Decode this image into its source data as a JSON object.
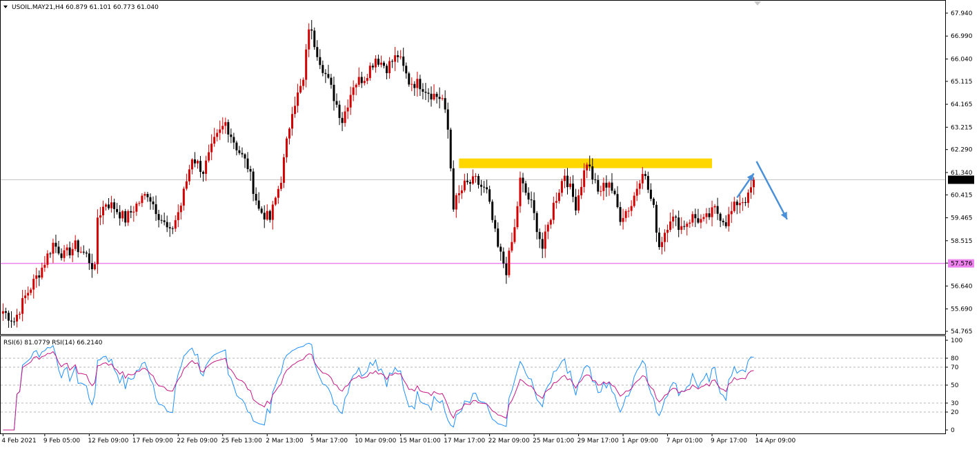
{
  "chart_data": [
    {
      "type": "candlestick",
      "header": "USOIL.MAY21,H4  60.879 61.101 60.773 61.040",
      "ylim": [
        54.48,
        68.3
      ],
      "yticks": [
        "67.940",
        "66.990",
        "66.040",
        "65.115",
        "64.165",
        "63.215",
        "62.290",
        "61.340",
        "60.415",
        "59.465",
        "58.515",
        "57.590",
        "56.640",
        "55.690",
        "54.765"
      ],
      "current_price": "61.040",
      "horizontal_lines": [
        {
          "value": 61.04,
          "color": "#c0c0c0",
          "label": "61.040"
        },
        {
          "value": 57.576,
          "color": "#ee82ee",
          "label": "57.576"
        }
      ],
      "resistance_zone": {
        "low": 61.52,
        "high": 61.92,
        "color": "#ffd700",
        "from_bar": 164,
        "to_bar": 255
      },
      "colors": {
        "bull": "#d40000",
        "bear": "#000000",
        "arrow": "#4a90d9"
      },
      "anchors": [
        [
          0,
          55.6
        ],
        [
          4,
          55.2
        ],
        [
          8,
          56.2
        ],
        [
          10,
          56.6
        ],
        [
          14,
          57.4
        ],
        [
          18,
          58.4
        ],
        [
          22,
          57.9
        ],
        [
          26,
          58.3
        ],
        [
          30,
          57.9
        ],
        [
          33,
          57.3
        ],
        [
          34,
          59.5
        ],
        [
          37,
          60.1
        ],
        [
          40,
          59.9
        ],
        [
          44,
          59.4
        ],
        [
          48,
          60.0
        ],
        [
          52,
          60.5
        ],
        [
          56,
          59.6
        ],
        [
          60,
          58.8
        ],
        [
          64,
          60.0
        ],
        [
          68,
          62.0
        ],
        [
          72,
          61.4
        ],
        [
          76,
          62.6
        ],
        [
          80,
          63.4
        ],
        [
          84,
          62.4
        ],
        [
          88,
          61.6
        ],
        [
          92,
          59.8
        ],
        [
          96,
          59.4
        ],
        [
          100,
          61.1
        ],
        [
          104,
          64.0
        ],
        [
          108,
          65.1
        ],
        [
          110,
          67.4
        ],
        [
          114,
          66.0
        ],
        [
          118,
          64.8
        ],
        [
          122,
          63.5
        ],
        [
          126,
          65.0
        ],
        [
          130,
          65.3
        ],
        [
          134,
          66.1
        ],
        [
          138,
          65.7
        ],
        [
          142,
          66.2
        ],
        [
          146,
          65.1
        ],
        [
          150,
          65.0
        ],
        [
          154,
          64.6
        ],
        [
          158,
          64.4
        ],
        [
          160,
          63.1
        ],
        [
          162,
          60.0
        ],
        [
          166,
          60.8
        ],
        [
          170,
          61.0
        ],
        [
          174,
          60.5
        ],
        [
          178,
          58.2
        ],
        [
          181,
          57.3
        ],
        [
          184,
          59.0
        ],
        [
          186,
          61.0
        ],
        [
          190,
          60.0
        ],
        [
          194,
          58.2
        ],
        [
          198,
          60.0
        ],
        [
          202,
          61.3
        ],
        [
          206,
          60.0
        ],
        [
          210,
          61.8
        ],
        [
          214,
          60.5
        ],
        [
          218,
          61.0
        ],
        [
          222,
          59.5
        ],
        [
          226,
          60.0
        ],
        [
          230,
          61.5
        ],
        [
          234,
          59.8
        ],
        [
          236,
          58.3
        ],
        [
          240,
          59.5
        ],
        [
          244,
          59.1
        ],
        [
          248,
          59.5
        ],
        [
          252,
          59.3
        ],
        [
          256,
          59.8
        ],
        [
          260,
          59.3
        ],
        [
          264,
          60.1
        ],
        [
          268,
          60.3
        ],
        [
          270,
          61.04
        ]
      ],
      "xticks": [
        {
          "bar": 0,
          "label": "4 Feb 2021"
        },
        {
          "bar": 15,
          "label": "9 Feb 05:00"
        },
        {
          "bar": 31,
          "label": "12 Feb 09:00"
        },
        {
          "bar": 47,
          "label": "17 Feb 09:00"
        },
        {
          "bar": 63,
          "label": "22 Feb 09:00"
        },
        {
          "bar": 79,
          "label": "25 Feb 13:00"
        },
        {
          "bar": 95,
          "label": "2 Mar 13:00"
        },
        {
          "bar": 111,
          "label": "5 Mar 17:00"
        },
        {
          "bar": 127,
          "label": "10 Mar 09:00"
        },
        {
          "bar": 143,
          "label": "15 Mar 01:00"
        },
        {
          "bar": 159,
          "label": "17 Mar 17:00"
        },
        {
          "bar": 175,
          "label": "22 Mar 09:00"
        },
        {
          "bar": 191,
          "label": "25 Mar 01:00"
        },
        {
          "bar": 207,
          "label": "29 Mar 17:00"
        },
        {
          "bar": 223,
          "label": "1 Apr 09:00"
        },
        {
          "bar": 239,
          "label": "7 Apr 01:00"
        },
        {
          "bar": 255,
          "label": "9 Apr 17:00"
        },
        {
          "bar": 271,
          "label": "14 Apr 09:00"
        }
      ],
      "arrows": [
        {
          "from": [
            264,
            60.3
          ],
          "to": [
            270,
            61.3
          ]
        },
        {
          "from": [
            271,
            61.8
          ],
          "to": [
            282,
            59.4
          ]
        }
      ]
    },
    {
      "type": "line",
      "header": "RSI(6) 81.0779  RSI(14) 66.2140",
      "ylim": [
        0,
        100
      ],
      "yticks": [
        "100",
        "80",
        "70",
        "50",
        "30",
        "20",
        "0"
      ],
      "levels": [
        80,
        70,
        50,
        30,
        20
      ],
      "series": [
        {
          "name": "RSI(6)",
          "color": "#1e90ff"
        },
        {
          "name": "RSI(14)",
          "color": "#c71585"
        }
      ],
      "rsi6_final": 81.0779,
      "rsi14_final": 66.214
    }
  ]
}
